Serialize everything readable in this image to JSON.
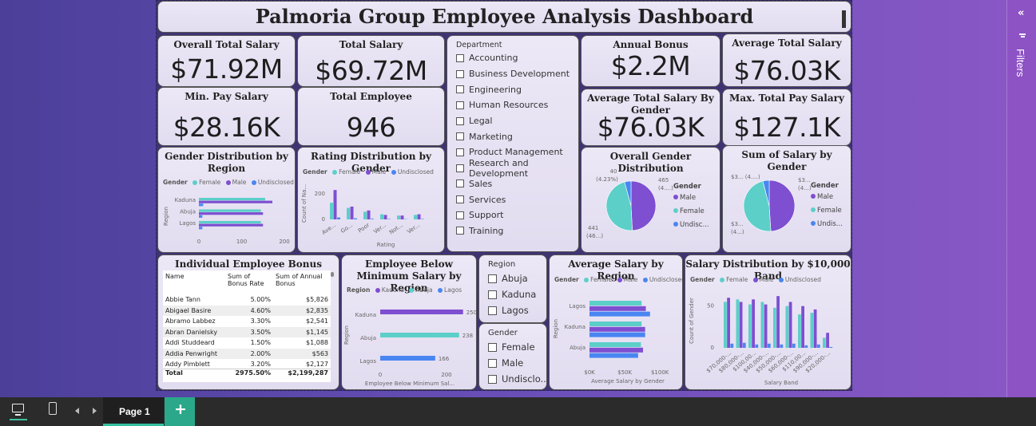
{
  "header": {
    "title": "Palmoria Group Employee Analysis Dashboard"
  },
  "kpis": {
    "overall_total_salary": {
      "label": "Overall Total Salary",
      "value": "$71.92M"
    },
    "total_salary": {
      "label": "Total Salary",
      "value": "$69.72M"
    },
    "min_pay_salary": {
      "label": "Min. Pay Salary",
      "value": "$28.16K"
    },
    "total_employee": {
      "label": "Total Employee",
      "value": "946"
    },
    "annual_bonus": {
      "label": "Annual Bonus",
      "value": "$2.2M"
    },
    "average_total_salary": {
      "label": "Average Total Salary",
      "value": "$76.03K"
    },
    "avg_salary_by_gender": {
      "label": "Average Total Salary By Gender",
      "value": "$76.03K"
    },
    "max_total_pay_salary": {
      "label": "Max. Total Pay Salary",
      "value": "$127.1K"
    }
  },
  "department_slicer": {
    "label": "Department",
    "items": [
      "Accounting",
      "Business Development",
      "Engineering",
      "Human Resources",
      "Legal",
      "Marketing",
      "Product Management",
      "Research and Development",
      "Sales",
      "Services",
      "Support",
      "Training"
    ]
  },
  "region_slicer": {
    "label": "Region",
    "items": [
      "Abuja",
      "Kaduna",
      "Lagos"
    ]
  },
  "gender_slicer": {
    "label": "Gender",
    "items": [
      "Female",
      "Male",
      "Undisclo..."
    ]
  },
  "legend": {
    "gender_title": "Gender",
    "region_title": "Region",
    "female": "Female",
    "male": "Male",
    "undisclosed": "Undisclosed",
    "kaduna": "Kaduna",
    "abuja": "Abuja",
    "lagos": "Lagos"
  },
  "colors": {
    "female": "#5ccfc9",
    "male": "#7e4fd1",
    "undisclosed": "#4a86f2",
    "card_bg": "#e6e1f2"
  },
  "gender_by_region": {
    "title": "Gender Distribution by Region",
    "ylabel": "Region",
    "ticks": [
      "0",
      "100",
      "200"
    ],
    "categories": [
      "Kaduna",
      "Abuja",
      "Lagos"
    ]
  },
  "rating_by_gender": {
    "title": "Rating Distribution by Gender",
    "ylabel": "Count of Na...",
    "xlabel": "Rating",
    "yticks": [
      "200",
      "0"
    ],
    "categories": [
      "Ave...",
      "Go...",
      "Poor",
      "Ver...",
      "Not...",
      "Ver..."
    ]
  },
  "overall_gender": {
    "title": "Overall Gender Distribution",
    "labels": {
      "top": "40",
      "top2": "(4.23%)",
      "right": "465",
      "right2": "(4....)",
      "bottom": "441",
      "bottom2": "(46...)"
    },
    "legend_items": [
      "Male",
      "Female",
      "Undisc..."
    ]
  },
  "salary_by_gender": {
    "title": "Sum of Salary by Gender",
    "labels": {
      "tl": "$3... (4....)",
      "tr": "$3...",
      "tr2": "(4...)",
      "bl": "$3...",
      "bl2": "(4...)"
    },
    "legend_items": [
      "Male",
      "Female",
      "Undis..."
    ]
  },
  "bonus_table": {
    "title": "Individual Employee Bonus Payment",
    "headers": [
      "Name",
      "Sum of Bonus Rate",
      "Sum of Annual Bonus"
    ],
    "rows": [
      [
        "Abbie Tann",
        "5.00%",
        "$5,826"
      ],
      [
        "Abigael Basire",
        "4.60%",
        "$2,835"
      ],
      [
        "Abramo Labbez",
        "3.30%",
        "$2,541"
      ],
      [
        "Abran Danielsky",
        "3.50%",
        "$1,145"
      ],
      [
        "Addi Studdeard",
        "1.50%",
        "$1,088"
      ],
      [
        "Addia Penwright",
        "2.00%",
        "$563"
      ],
      [
        "Addy Pimblett",
        "3.20%",
        "$2,127"
      ]
    ],
    "total": [
      "Total",
      "2975.50%",
      "$2,199,287"
    ]
  },
  "below_min": {
    "title": "Employee Below Minimum Salary by Region",
    "ylabel": "Region",
    "xlabel": "Employee Below Minimum Sal...",
    "ticks": [
      "0",
      "200"
    ],
    "categories": [
      "Kaduna",
      "Abuja",
      "Lagos"
    ],
    "value_labels": [
      "250",
      "238",
      "166"
    ]
  },
  "avg_by_region": {
    "title": "Average Salary by Region",
    "ylabel": "Region",
    "xlabel": "Average Salary by Gender",
    "ticks": [
      "$0K",
      "$50K",
      "$100K"
    ],
    "categories": [
      "Lagos",
      "Kaduna",
      "Abuja"
    ]
  },
  "salary_band": {
    "title": "Salary Distribution by $10,000 Band",
    "ylabel": "Count of Gender",
    "xlabel": "Salary Band",
    "yticks": [
      "50",
      "0"
    ],
    "categories": [
      "$70,000-...",
      "$80,000-...",
      "$100,00...",
      "$40,000-...",
      "$50,000-...",
      "$60,000-...",
      "$110,00...",
      "$90,000-...",
      "$20,000-..."
    ]
  },
  "chart_data": [
    {
      "type": "bar",
      "title": "Gender Distribution by Region",
      "ylabel": "Region",
      "orientation": "horizontal",
      "categories": [
        "Kaduna",
        "Abuja",
        "Lagos"
      ],
      "xlim": [
        0,
        200
      ],
      "series": [
        {
          "name": "Female",
          "values": [
            155,
            145,
            145
          ]
        },
        {
          "name": "Male",
          "values": [
            172,
            150,
            150
          ]
        },
        {
          "name": "Undisclosed",
          "values": [
            10,
            8,
            8
          ]
        }
      ]
    },
    {
      "type": "bar",
      "title": "Rating Distribution by Gender",
      "xlabel": "Rating",
      "ylabel": "Count of Na...",
      "categories": [
        "Ave...",
        "Go...",
        "Poor",
        "Ver...",
        "Not...",
        "Ver..."
      ],
      "series": [
        {
          "name": "Female",
          "values": [
            130,
            90,
            60,
            40,
            30,
            35
          ]
        },
        {
          "name": "Male",
          "values": [
            230,
            100,
            70,
            35,
            30,
            40
          ]
        },
        {
          "name": "Undisclosed",
          "values": [
            15,
            8,
            5,
            3,
            2,
            3
          ]
        }
      ]
    },
    {
      "type": "pie",
      "title": "Overall Gender Distribution",
      "categories": [
        "Male",
        "Female",
        "Undisclosed"
      ],
      "values": [
        465,
        441,
        40
      ]
    },
    {
      "type": "pie",
      "title": "Sum of Salary by Gender",
      "categories": [
        "Male",
        "Female",
        "Undisclosed"
      ],
      "values": [
        49,
        47,
        4
      ]
    },
    {
      "type": "bar",
      "title": "Employee Below Minimum Salary by Region",
      "orientation": "horizontal",
      "ylabel": "Region",
      "xlabel": "Employee Below Minimum Sal...",
      "categories": [
        "Kaduna",
        "Abuja",
        "Lagos"
      ],
      "values": [
        250,
        238,
        166
      ],
      "xlim": [
        0,
        270
      ]
    },
    {
      "type": "bar",
      "title": "Average Salary by Region",
      "orientation": "horizontal",
      "ylabel": "Region",
      "xlabel": "Average Salary by Gender",
      "categories": [
        "Lagos",
        "Kaduna",
        "Abuja"
      ],
      "xlim": [
        0,
        110000
      ],
      "series": [
        {
          "name": "Female",
          "values": [
            74000,
            74000,
            73000
          ]
        },
        {
          "name": "Male",
          "values": [
            80000,
            79000,
            76000
          ]
        },
        {
          "name": "Undisclosed",
          "values": [
            86000,
            79000,
            69000
          ]
        }
      ]
    },
    {
      "type": "bar",
      "title": "Salary Distribution by $10,000 Band",
      "xlabel": "Salary Band",
      "ylabel": "Count of Gender",
      "categories": [
        "$70,000-...",
        "$80,000-...",
        "$100,00...",
        "$40,000-...",
        "$50,000-...",
        "$60,000-...",
        "$110,00...",
        "$90,000-...",
        "$20,000-..."
      ],
      "series": [
        {
          "name": "Female",
          "values": [
            55,
            58,
            52,
            55,
            48,
            50,
            40,
            42,
            12
          ]
        },
        {
          "name": "Male",
          "values": [
            60,
            55,
            58,
            52,
            62,
            55,
            50,
            46,
            18
          ]
        },
        {
          "name": "Undisclosed",
          "values": [
            5,
            6,
            4,
            5,
            4,
            5,
            3,
            4,
            1
          ]
        }
      ]
    }
  ],
  "tabs": {
    "page1": "Page 1",
    "add": "+"
  },
  "filters": {
    "label": "Filters",
    "collapse": "«"
  }
}
